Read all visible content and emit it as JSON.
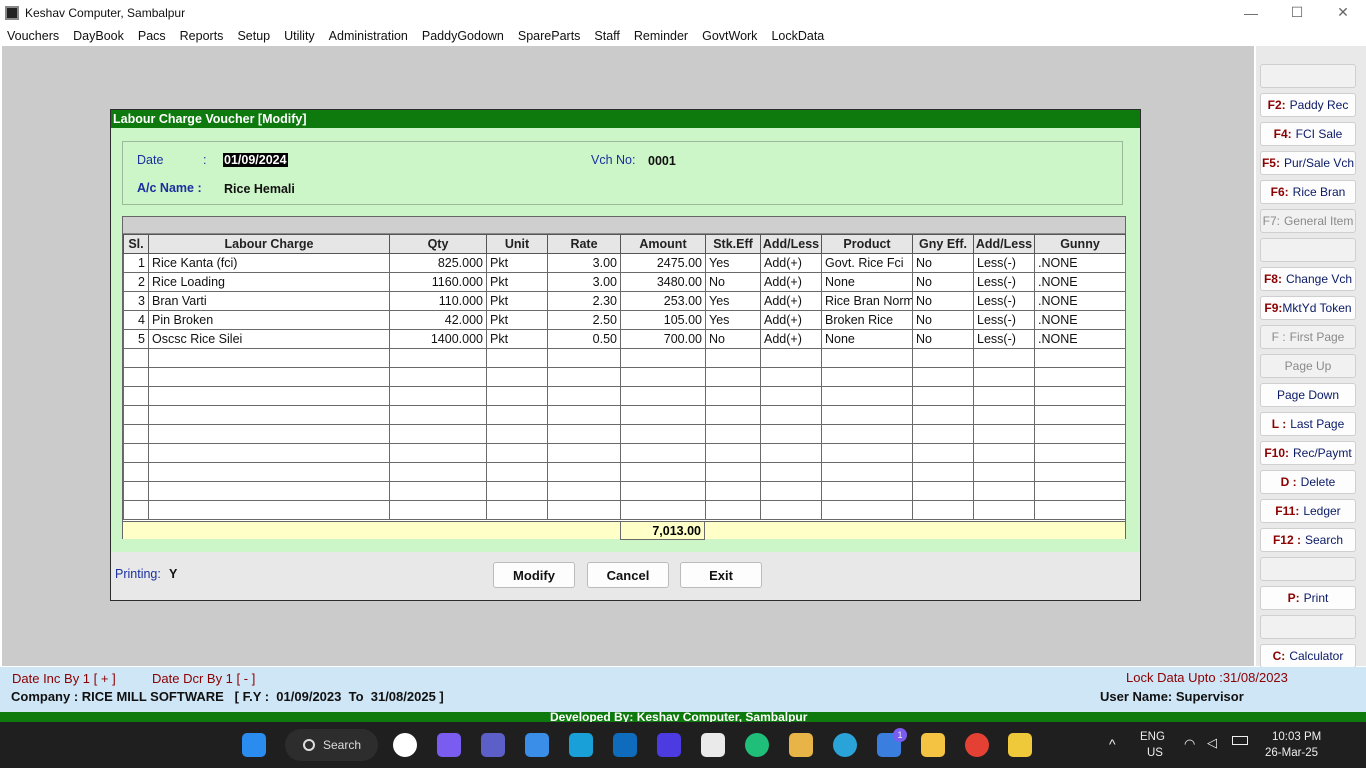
{
  "window": {
    "title": "Keshav Computer, Sambalpur",
    "min": "—",
    "max": "☐",
    "close": "✕"
  },
  "menu": [
    "Vouchers",
    "DayBook",
    "Pacs",
    "Reports",
    "Setup",
    "Utility",
    "Administration",
    "PaddyGodown",
    "SpareParts",
    "Staff",
    "Reminder",
    "GovtWork",
    "LockData"
  ],
  "sidebar": [
    {
      "key": "",
      "label": "",
      "disabled": true
    },
    {
      "key": "F2:",
      "label": "Paddy Rec",
      "disabled": false
    },
    {
      "key": "F4:",
      "label": "FCI Sale",
      "disabled": false
    },
    {
      "key": "F5:",
      "label": "Pur/Sale Vch",
      "disabled": false
    },
    {
      "key": "F6:",
      "label": "Rice Bran",
      "disabled": false
    },
    {
      "key": "F7:",
      "label": "General Item",
      "disabled": true
    },
    {
      "key": "",
      "label": "",
      "disabled": true
    },
    {
      "key": "F8:",
      "label": "Change  Vch",
      "disabled": false
    },
    {
      "key": "F9:",
      "label": "MktYd Token",
      "disabled": false
    },
    {
      "key": "F :",
      "label": "First Page",
      "disabled": true
    },
    {
      "key": "",
      "label": "Page Up",
      "disabled": true
    },
    {
      "key": "",
      "label": "Page Down",
      "disabled": false
    },
    {
      "key": "L :",
      "label": "Last Page",
      "disabled": false
    },
    {
      "key": "F10:",
      "label": "Rec/Paymt",
      "disabled": false
    },
    {
      "key": "D :",
      "label": "Delete",
      "disabled": false
    },
    {
      "key": "F11:",
      "label": "Ledger",
      "disabled": false
    },
    {
      "key": "F12 :",
      "label": "Search",
      "disabled": false
    },
    {
      "key": "",
      "label": "",
      "disabled": true
    },
    {
      "key": "P:",
      "label": "Print",
      "disabled": false
    },
    {
      "key": "",
      "label": "",
      "disabled": true
    },
    {
      "key": "C:",
      "label": "Calculator",
      "disabled": false
    }
  ],
  "voucher": {
    "title": "Labour Charge Voucher [Modify]",
    "date_label": "Date",
    "colon": ":",
    "date_value": "01/09/2024",
    "vch_label": "Vch No:",
    "vch_value": "0001",
    "ac_label": "A/c Name :",
    "ac_value": "Rice Hemali",
    "columns": [
      "Sl.",
      "Labour Charge",
      "Qty",
      "Unit",
      "Rate",
      "Amount",
      "Stk.Eff",
      "Add/Less",
      "Product",
      "Gny Eff.",
      "Add/Less",
      "Gunny"
    ],
    "rows": [
      [
        "1",
        "Rice Kanta (fci)",
        "825.000",
        "Pkt",
        "3.00",
        "2475.00",
        "Yes",
        "Add(+)",
        "Govt. Rice Fci",
        "No",
        "Less(-)",
        ".NONE"
      ],
      [
        "2",
        "Rice Loading",
        "1160.000",
        "Pkt",
        "3.00",
        "3480.00",
        "No",
        "Add(+)",
        "None",
        "No",
        "Less(-)",
        ".NONE"
      ],
      [
        "3",
        "Bran Varti",
        "110.000",
        "Pkt",
        "2.30",
        "253.00",
        "Yes",
        "Add(+)",
        "Rice Bran Norm",
        "No",
        "Less(-)",
        ".NONE"
      ],
      [
        "4",
        "Pin Broken",
        "42.000",
        "Pkt",
        "2.50",
        "105.00",
        "Yes",
        "Add(+)",
        "Broken Rice",
        "No",
        "Less(-)",
        ".NONE"
      ],
      [
        "5",
        "Oscsc Rice Silei",
        "1400.000",
        "Pkt",
        "0.50",
        "700.00",
        "No",
        "Add(+)",
        "None",
        "No",
        "Less(-)",
        ".NONE"
      ]
    ],
    "empty_rows": 9,
    "total": "7,013.00",
    "printing_label": "Printing:",
    "printing_value": "Y",
    "buttons": {
      "modify": "Modify",
      "cancel": "Cancel",
      "exit": "Exit"
    }
  },
  "status": {
    "date_inc": "Date Inc By 1 [ + ]",
    "date_dcr": "Date Dcr By 1 [ - ]",
    "lock": "Lock Data Upto :31/08/2023",
    "company": "Company : RICE MILL SOFTWARE   [ F.Y :  01/09/2023  To  31/08/2025 ]",
    "user": "User Name: Supervisor",
    "developed": "Developed By: Keshav Computer, Sambalpur"
  },
  "taskbar": {
    "search": "Search",
    "lang1": "ENG",
    "lang2": "US",
    "time": "10:03 PM",
    "date": "26-Mar-25",
    "badge": "1"
  },
  "colors": {
    "green": "#0e7a0e",
    "mint": "#ccf5c8",
    "navy": "#1a2fa0",
    "maroon": "#8b0000"
  }
}
